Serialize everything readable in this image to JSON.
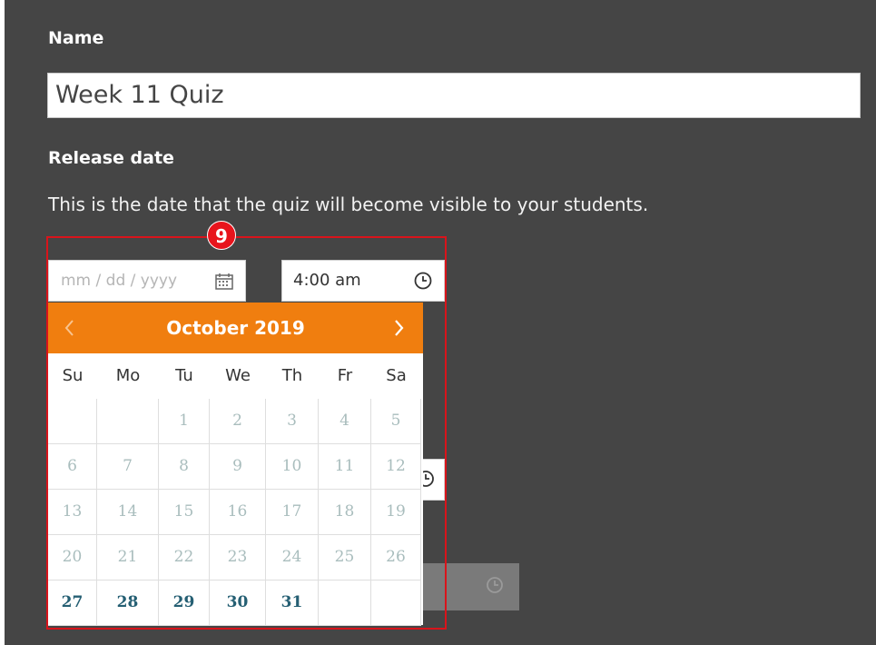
{
  "form": {
    "name_label": "Name",
    "name_value": "Week 11 Quiz",
    "release_label": "Release date",
    "release_description": "This is the date that the quiz will become visible to your students.",
    "date_placeholder": "mm / dd / yyyy",
    "time_value": "4:00 am"
  },
  "calendar": {
    "month_title": "October 2019",
    "weekdays": [
      "Su",
      "Mo",
      "Tu",
      "We",
      "Th",
      "Fr",
      "Sa"
    ],
    "weeks": [
      [
        "",
        "",
        "1",
        "2",
        "3",
        "4",
        "5"
      ],
      [
        "6",
        "7",
        "8",
        "9",
        "10",
        "11",
        "12"
      ],
      [
        "13",
        "14",
        "15",
        "16",
        "17",
        "18",
        "19"
      ],
      [
        "20",
        "21",
        "22",
        "23",
        "24",
        "25",
        "26"
      ],
      [
        "27",
        "28",
        "29",
        "30",
        "31",
        "",
        ""
      ]
    ],
    "enabled_days": [
      "27",
      "28",
      "29",
      "30",
      "31"
    ],
    "accent_color": "#f07e0f"
  },
  "annotation": {
    "badge_number": "9",
    "highlight_color": "#d9141b"
  },
  "icons": {
    "date_icon": "calendar-icon",
    "time_icon": "clock-icon",
    "prev": "chevron-left-icon",
    "next": "chevron-right-icon"
  }
}
